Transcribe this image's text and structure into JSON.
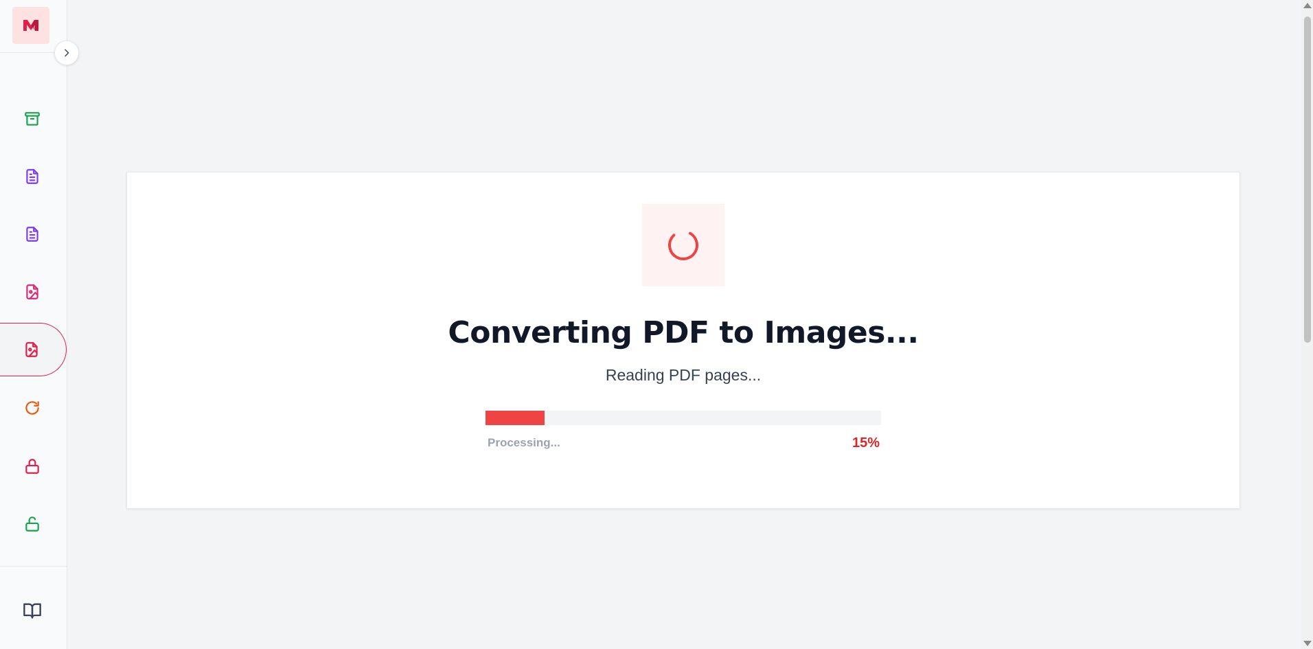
{
  "app": {
    "logo_icon": "brand-logo-icon",
    "brand_color": "#e11d48"
  },
  "sidebar": {
    "collapse_icon": "chevron-right-icon",
    "items": [
      {
        "icon": "archive-icon",
        "color": "#16a34a"
      },
      {
        "icon": "file-text-icon",
        "color": "#7c3aed"
      },
      {
        "icon": "file-text-icon",
        "color": "#7c3aed"
      },
      {
        "icon": "file-image-icon",
        "color": "#db2777"
      },
      {
        "icon": "file-image-icon",
        "color": "#e11d48",
        "active": true
      },
      {
        "icon": "rotate-icon",
        "color": "#ea580c"
      },
      {
        "icon": "lock-icon",
        "color": "#e11d48"
      },
      {
        "icon": "unlock-icon",
        "color": "#16a34a"
      }
    ],
    "bottom_icon": "book-open-icon"
  },
  "conversion": {
    "spinner_icon": "loading-spinner-icon",
    "title": "Converting PDF to Images...",
    "subtitle": "Reading PDF pages...",
    "status_label": "Processing...",
    "progress": 0.15,
    "progress_text": "15%",
    "accent_color": "#ef4444"
  }
}
